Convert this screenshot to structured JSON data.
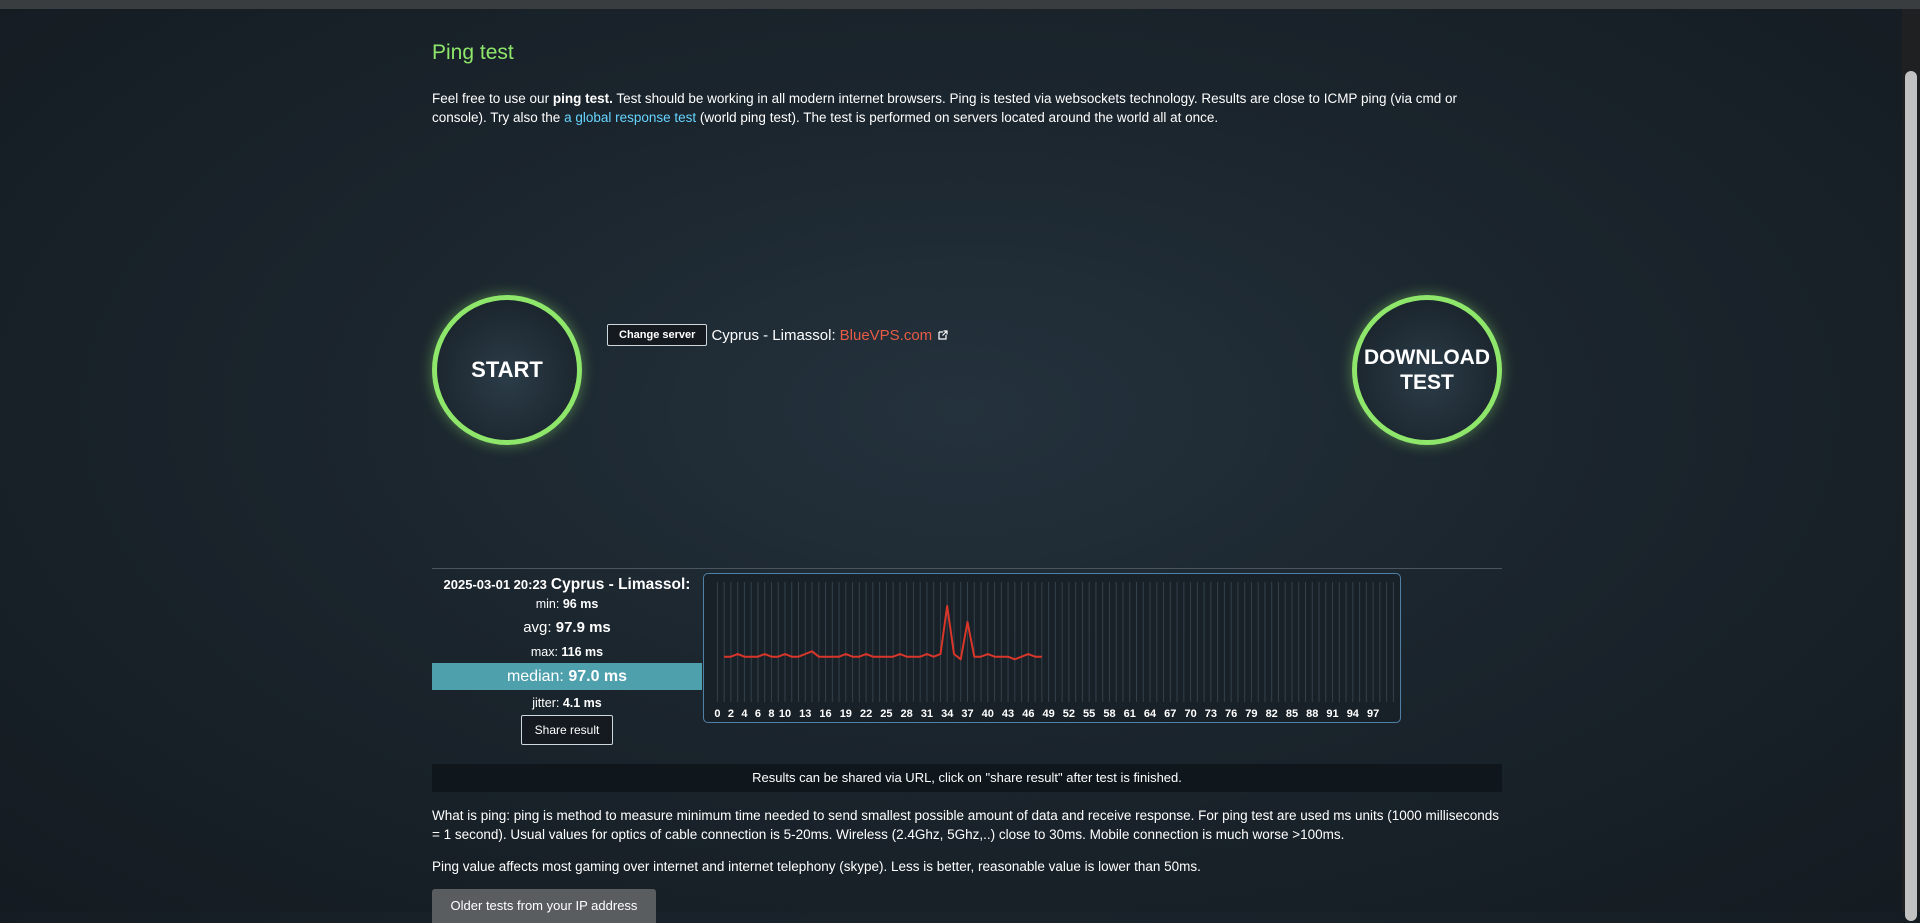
{
  "page": {
    "title": "Ping test"
  },
  "intro": {
    "t1": "Feel free to use our ",
    "t2": "ping test.",
    "t3": " Test should be working in all modern internet browsers. Ping is tested via websockets technology. Results are close to ICMP ping (via cmd or console). Try also the ",
    "link": "a global response test",
    "t4": " (world ping test). The test is performed on servers located around the world all at once."
  },
  "controls": {
    "start_label": "START",
    "download_label_1": "DOWNLOAD",
    "download_label_2": "TEST",
    "change_server_label": "Change server",
    "server_location": "Cyprus - Limassol:",
    "server_provider": "BlueVPS.com"
  },
  "result": {
    "datetime": "2025-03-01 20:23",
    "location": "Cyprus - Limassol:",
    "min_label": "min:",
    "min_value": "96 ms",
    "avg_label": "avg:",
    "avg_value": "97.9 ms",
    "max_label": "max:",
    "max_value": "116 ms",
    "median_label": "median:",
    "median_value": "97.0 ms",
    "jitter_label": "jitter:",
    "jitter_value": "4.1 ms",
    "share_label": "Share result"
  },
  "colors": {
    "accent_green": "#8ee66a",
    "link_blue": "#66d4ff",
    "provider_red": "#e85b45",
    "median_bg": "#4fa0ad",
    "graph_line": "#d9362a"
  },
  "chart_data": {
    "type": "line",
    "x_tick_labels": [
      "0",
      "2",
      "4",
      "6",
      "8",
      "10",
      "13",
      "16",
      "19",
      "22",
      "25",
      "28",
      "31",
      "34",
      "37",
      "40",
      "43",
      "46",
      "49",
      "52",
      "55",
      "58",
      "61",
      "64",
      "67",
      "70",
      "73",
      "76",
      "79",
      "82",
      "85",
      "88",
      "91",
      "94",
      "97"
    ],
    "xlim": [
      0,
      100
    ],
    "series": [
      {
        "values": [
          97,
          97,
          98,
          97,
          97,
          97,
          98,
          97,
          97,
          98,
          97,
          97,
          98,
          99,
          97,
          97,
          97,
          97,
          98,
          97,
          97,
          98,
          97,
          97,
          97,
          97,
          98,
          97,
          97,
          97,
          98,
          97,
          98,
          116,
          98,
          96,
          110,
          97,
          97,
          98,
          97,
          97,
          97,
          96,
          97,
          98,
          97,
          97
        ]
      }
    ]
  },
  "share_info": "Results can be shared via URL, click on \"share result\" after test is finished.",
  "info": {
    "para1": "What is ping: ping is method to measure minimum time needed to send smallest possible amount of data and receive response. For ping test are used ms units (1000 milliseconds = 1 second). Usual values for optics of cable connection is 5-20ms. Wireless (2.4Ghz, 5Ghz,..) close to 30ms. Mobile connection is much worse >100ms.",
    "para2": "Ping value affects most gaming over internet and internet telephony (skype). Less is better, reasonable value is lower than 50ms.",
    "older_tests_label": "Older tests from your IP address"
  }
}
